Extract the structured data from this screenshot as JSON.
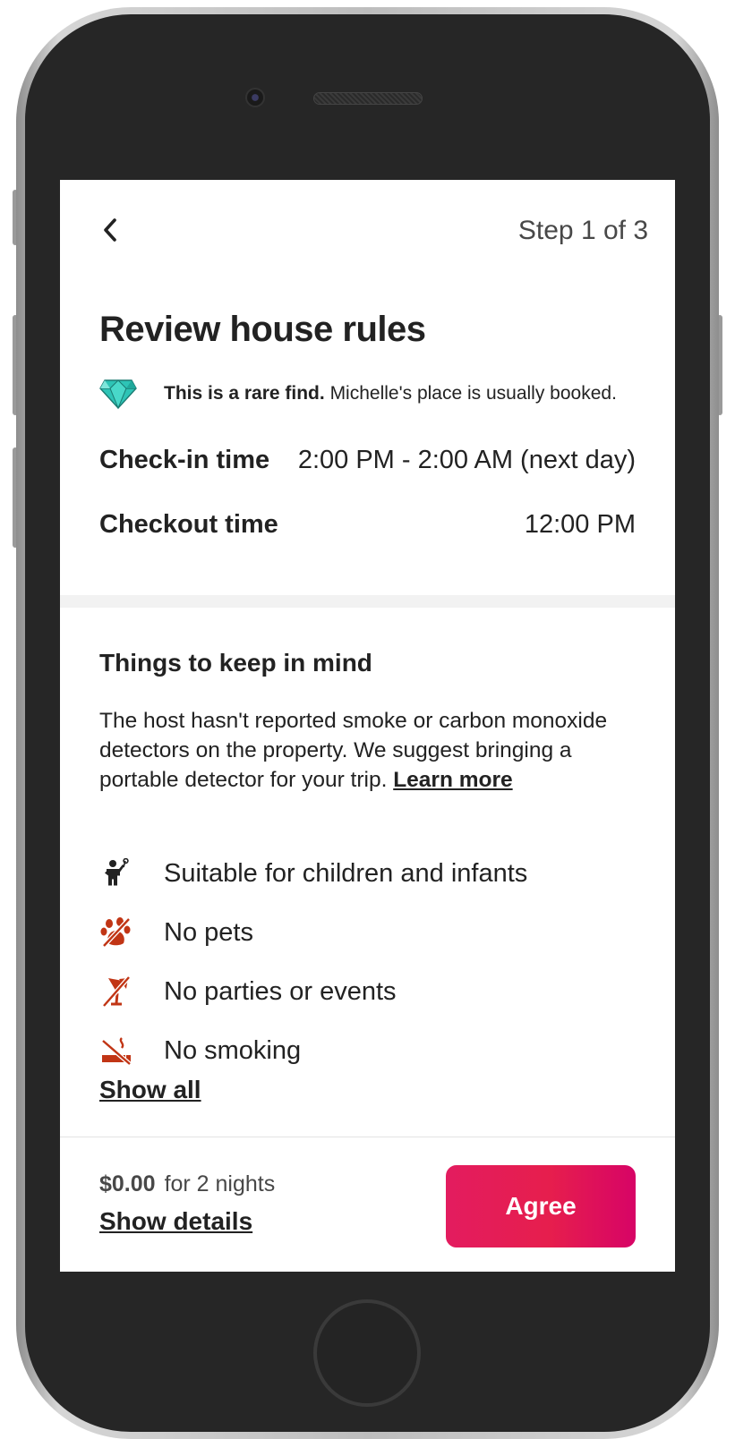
{
  "header": {
    "back_icon": "chevron-left-icon",
    "step_label": "Step 1 of 3"
  },
  "main": {
    "title": "Review house rules",
    "rare_find": {
      "icon": "diamond-icon",
      "bold_text": "This is a rare find.",
      "text": " Michelle's place is usually booked."
    },
    "times": [
      {
        "label": "Check-in time",
        "value": "2:00 PM - 2:00 AM (next day)"
      },
      {
        "label": "Checkout time",
        "value": "12:00 PM"
      }
    ]
  },
  "things_to_keep_in_mind": {
    "title": "Things to keep in mind",
    "warning_text": "The host hasn't reported smoke or carbon monoxide detectors on the property. We suggest bringing a portable detector for your trip. ",
    "learn_more_label": "Learn more",
    "rules": [
      {
        "icon": "child-icon",
        "label": "Suitable for children and infants"
      },
      {
        "icon": "no-pets-icon",
        "label": "No pets"
      },
      {
        "icon": "no-parties-icon",
        "label": "No parties or events"
      },
      {
        "icon": "no-smoking-icon",
        "label": "No smoking"
      }
    ],
    "show_all_label": "Show all"
  },
  "footer": {
    "price": "$0.00",
    "price_suffix": "for 2 nights",
    "show_details_label": "Show details",
    "agree_label": "Agree"
  },
  "colors": {
    "accent": "#e61e4d",
    "rule_icon": "#c13515",
    "text": "#222222",
    "gem": "#2ec4b6"
  }
}
